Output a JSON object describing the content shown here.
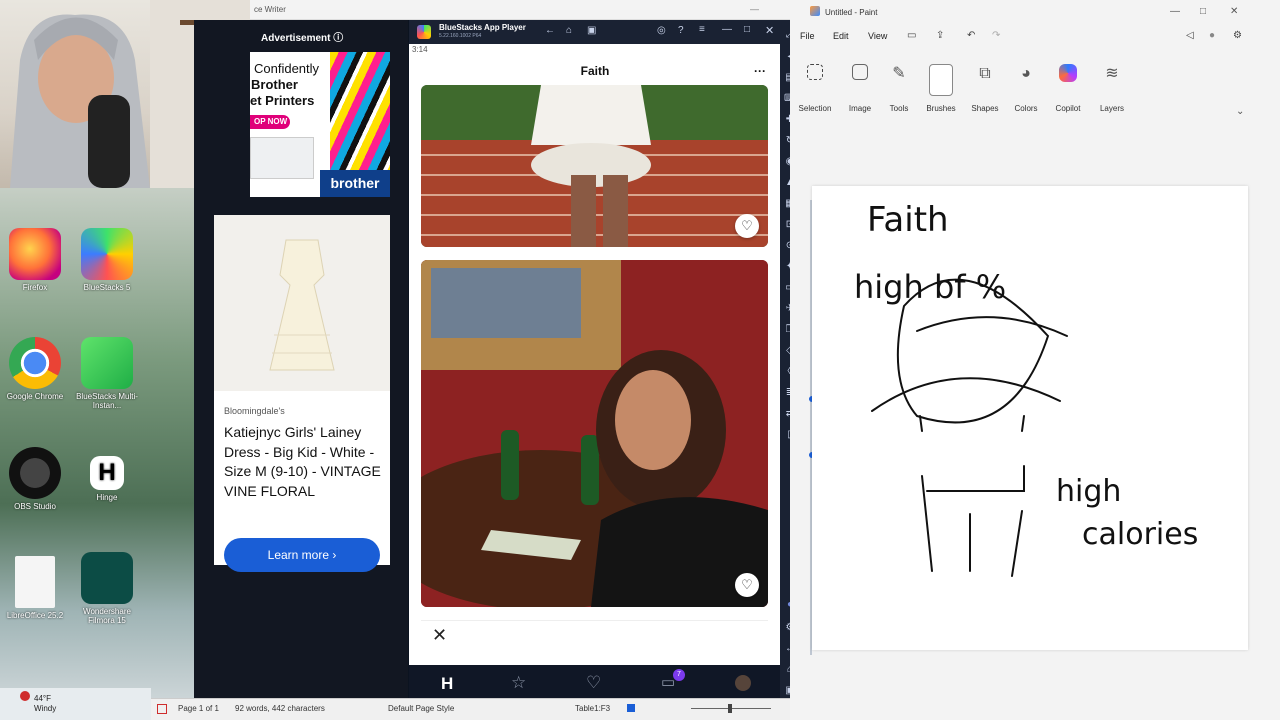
{
  "desktop": {
    "icons": [
      {
        "label": "Firefox",
        "name": "firefox-icon"
      },
      {
        "label": "BlueStacks 5",
        "name": "bluestacks-icon"
      },
      {
        "label": "Google Chrome",
        "name": "chrome-icon"
      },
      {
        "label": "BlueStacks Multi-Instan...",
        "name": "bluestacks-multi-icon"
      },
      {
        "label": "OBS Studio",
        "name": "obs-icon"
      },
      {
        "label": "Hinge",
        "name": "hinge-icon"
      },
      {
        "label": "LibreOffice 25.2",
        "name": "libreoffice-icon"
      },
      {
        "label": "Wondershare Filmora 15",
        "name": "filmora-icon"
      }
    ],
    "weather": {
      "temp": "44°F",
      "cond": "Windy"
    }
  },
  "writer": {
    "title_fragment": "ce Writer",
    "status": {
      "page": "Page 1 of 1",
      "words": "92 words, 442 characters",
      "style": "Default Page Style",
      "table": "Table1:F3"
    }
  },
  "ad_panel": {
    "header": "Advertisement ⓘ",
    "brother": {
      "line1": "Confidently",
      "line2": "Brother",
      "line3": "et Printers",
      "cta": "OP NOW",
      "brand": "brother"
    },
    "product": {
      "store": "Bloomingdale's",
      "title": "Katiejnyc Girls' Lainey Dress - Big Kid - White - Size M (9-10) - VINTAGE VINE FLORAL",
      "button": "Learn more ›"
    }
  },
  "bluestacks": {
    "app_title": "BlueStacks App Player",
    "version": "5.22.160.1002 P64",
    "status_time": "3:14",
    "profile_name": "Faith",
    "menu": "···",
    "close_glyph": "✕",
    "chat_badge": "7"
  },
  "paint": {
    "window_title": "Untitled - Paint",
    "menu": [
      "File",
      "Edit",
      "View"
    ],
    "tools": [
      "Selection",
      "Image",
      "Tools",
      "Brushes",
      "Shapes",
      "Colors",
      "Copilot",
      "Layers"
    ],
    "canvas_text": {
      "name": "Faith",
      "line1": "high bf %",
      "line2a": "high",
      "line2b": "calories"
    }
  },
  "colors": {
    "accent": "#1a5ed6",
    "bs_dark": "#1a2233",
    "ad_dark": "#121722"
  }
}
